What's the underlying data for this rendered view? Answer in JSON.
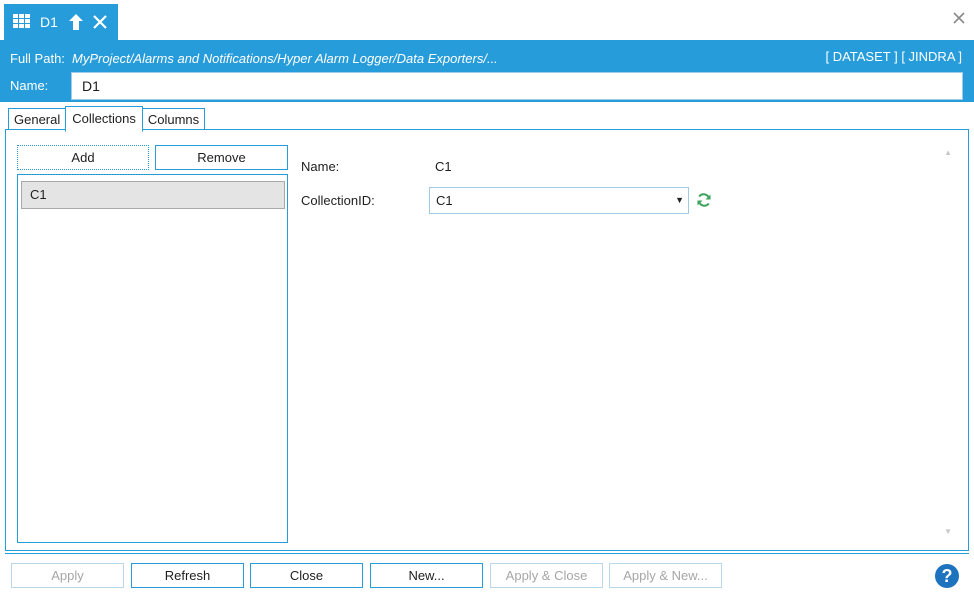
{
  "tab": {
    "title": "D1"
  },
  "header": {
    "fullpath_label": "Full Path:",
    "fullpath_value": "MyProject/Alarms and Notifications/Hyper Alarm Logger/Data Exporters/...",
    "tags": "[ DATASET ] [ JINDRA ]",
    "name_label": "Name:",
    "name_value": "D1"
  },
  "tabs": [
    "General",
    "Collections",
    "Columns"
  ],
  "collections": {
    "add_label": "Add",
    "remove_label": "Remove",
    "items": [
      "C1"
    ],
    "name_label": "Name:",
    "name_value": "C1",
    "collection_id_label": "CollectionID:",
    "collection_id_value": "C1"
  },
  "footer": {
    "apply": "Apply",
    "refresh": "Refresh",
    "close": "Close",
    "new": "New...",
    "apply_close": "Apply & Close",
    "apply_new": "Apply & New...",
    "help": "?"
  },
  "colors": {
    "accent": "#279cda",
    "refresh_icon": "#3aa35c",
    "help": "#1e73be"
  }
}
